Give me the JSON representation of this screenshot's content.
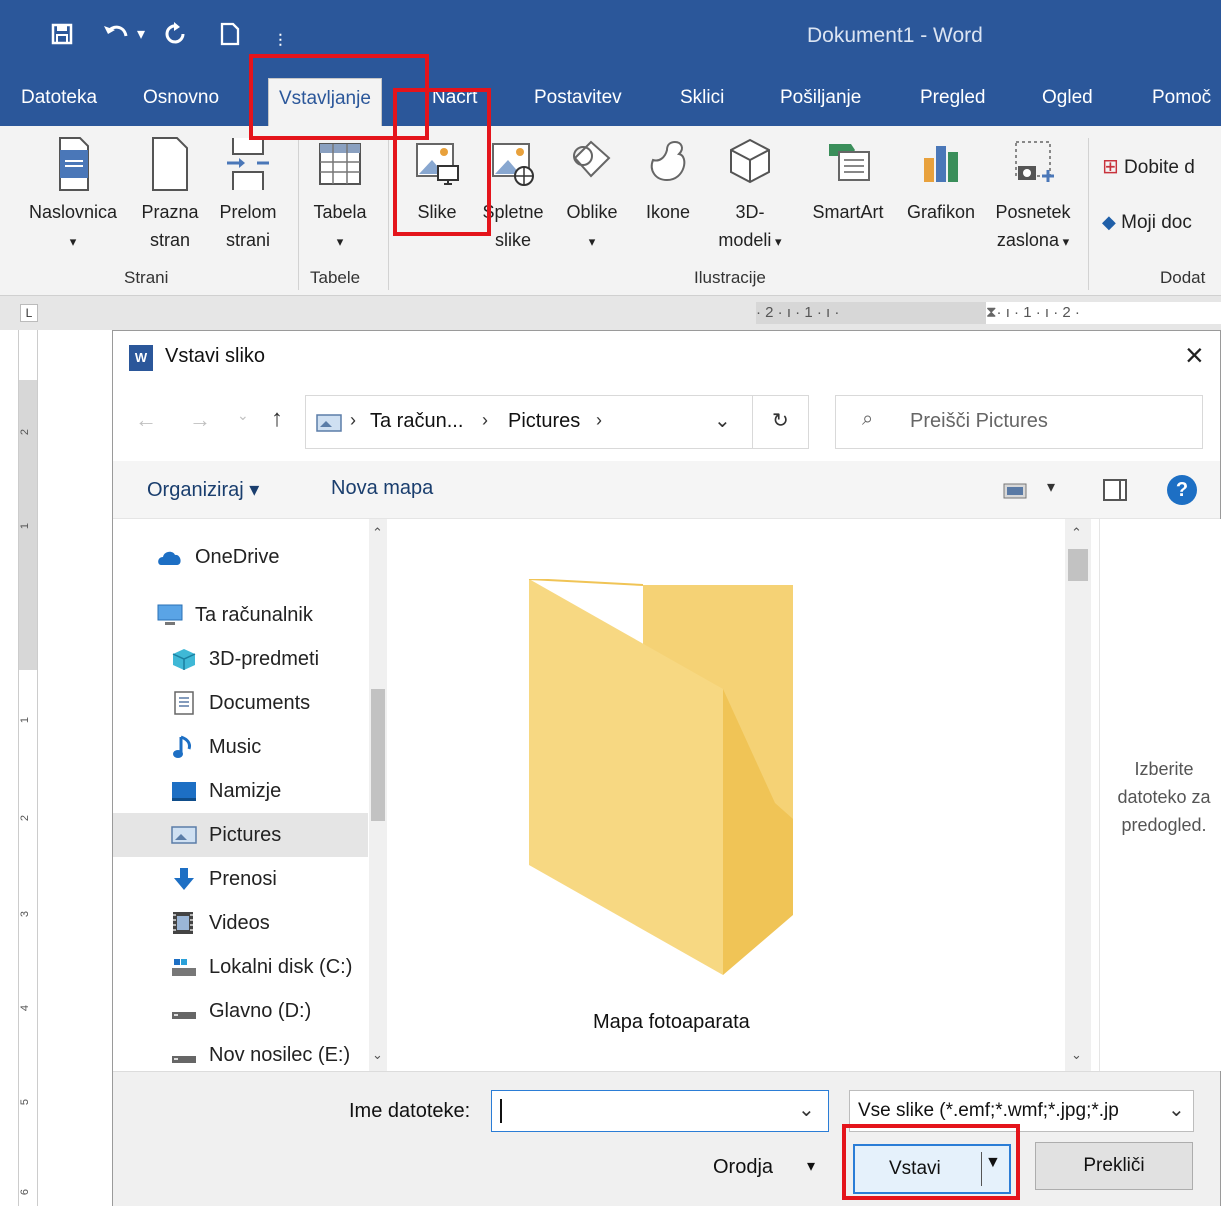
{
  "window": {
    "title": "Dokument1  -  Word"
  },
  "quick_access": {
    "save": "save-icon",
    "undo": "undo-icon",
    "redo": "redo-icon",
    "new": "new-doc-icon",
    "customize": "customize-icon"
  },
  "tabs": [
    "Datoteka",
    "Osnovno",
    "Vstavljanje",
    "Načrt",
    "Postavitev",
    "Sklici",
    "Pošiljanje",
    "Pregled",
    "Ogled",
    "Pomoč"
  ],
  "active_tab": "Vstavljanje",
  "ribbon": {
    "pages": {
      "cover_line1": "Naslovnica",
      "blank_line1": "Prazna",
      "blank_line2": "stran",
      "break_line1": "Prelom",
      "break_line2": "strani",
      "group": "Strani"
    },
    "tables": {
      "table": "Tabela",
      "group": "Tabele"
    },
    "illustrations": {
      "pictures": "Slike",
      "online_line1": "Spletne",
      "online_line2": "slike",
      "shapes": "Oblike",
      "icons": "Ikone",
      "models_line1": "3D-",
      "models_line2": "modeli",
      "smartart": "SmartArt",
      "chart": "Grafikon",
      "screenshot_line1": "Posnetek",
      "screenshot_line2": "zaslona",
      "group": "Ilustracije"
    },
    "addins": {
      "get": "Dobite d",
      "my": "Moji doc",
      "group": "Dodat"
    }
  },
  "ruler": {
    "corner": "L",
    "marks": "· 2 · ı · 1 · ı ·",
    "marks_right": "· ı · 1 · ı · 2 ·"
  },
  "vruler_marks": [
    "2",
    "1",
    "1",
    "2",
    "3",
    "4",
    "5",
    "6"
  ],
  "dialog": {
    "title": "Vstavi sliko",
    "close": "×",
    "breadcrumb": [
      "Ta račun...",
      "Pictures"
    ],
    "search_placeholder": "Preišči Pictures",
    "toolbar": {
      "organize": "Organiziraj ▾",
      "new_folder": "Nova mapa"
    },
    "nav_items": [
      {
        "label": "OneDrive",
        "icon": "cloud-icon"
      },
      {
        "label": "Ta računalnik",
        "icon": "computer-icon"
      },
      {
        "label": "3D-predmeti",
        "icon": "cube-icon"
      },
      {
        "label": "Documents",
        "icon": "document-icon"
      },
      {
        "label": "Music",
        "icon": "music-icon"
      },
      {
        "label": "Namizje",
        "icon": "desktop-icon"
      },
      {
        "label": "Pictures",
        "icon": "pictures-icon"
      },
      {
        "label": "Prenosi",
        "icon": "download-icon"
      },
      {
        "label": "Videos",
        "icon": "video-icon"
      },
      {
        "label": "Lokalni disk (C:)",
        "icon": "drive-icon"
      },
      {
        "label": "Glavno (D:)",
        "icon": "drive-icon"
      },
      {
        "label": "Nov nosilec (E:)",
        "icon": "drive-icon"
      }
    ],
    "selected_nav": "Pictures",
    "folder_item": "Mapa fotoaparata",
    "preview_text": [
      "Izberite",
      "datoteko za",
      "predogled."
    ],
    "filename_label": "Ime datoteke:",
    "filename_value": "",
    "filetype": "Vse slike (*.emf;*.wmf;*.jpg;*.jp",
    "tools": "Orodja",
    "insert": "Vstavi",
    "cancel": "Prekliči"
  }
}
